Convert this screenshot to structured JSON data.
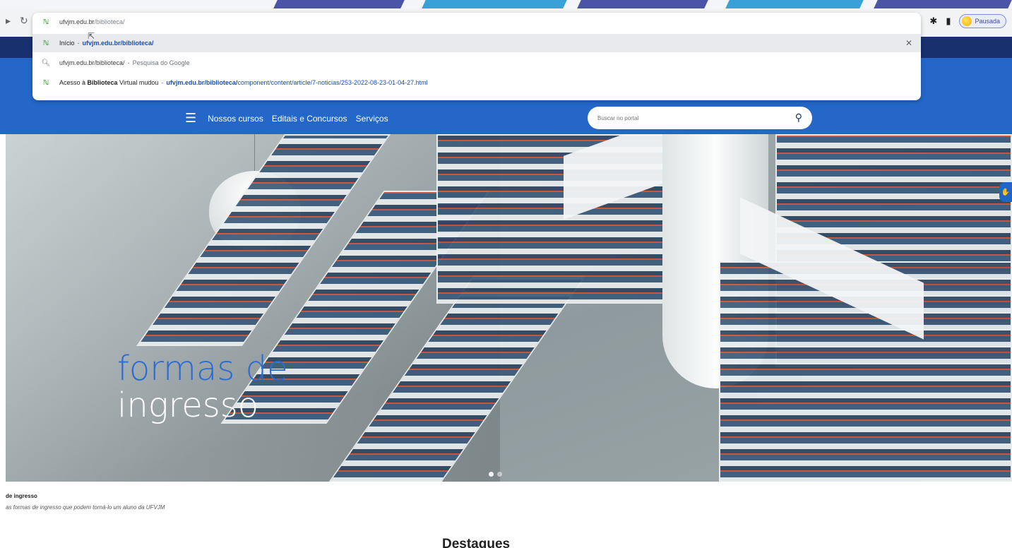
{
  "browser": {
    "address_text": "ufvjm.edu.br/biblioteca/",
    "address_host": "ufvjm.edu.br",
    "address_path": "/biblioteca/",
    "profile_label": "Pausada",
    "suggestions": [
      {
        "icon": "site-favicon",
        "title": "Início",
        "separator": "-",
        "url_bold": "ufvjm.edu.br/biblioteca/",
        "url_rest": ""
      },
      {
        "icon": "search-icon",
        "query": "ufvjm.edu.br/biblioteca/",
        "separator": "-",
        "source": "Pesquisa do Google"
      },
      {
        "icon": "site-favicon",
        "title_pre": "Acesso à ",
        "title_bold": "Biblioteca",
        "title_post": " Virtual mudou",
        "separator": "-",
        "url_bold": "ufvjm.edu.br/biblioteca/",
        "url_rest": "component/content/article/7-noticias/253-2022-08-23-01-04-27.html"
      }
    ]
  },
  "site": {
    "menu": [
      "Nossos cursos",
      "Editais e Concursos",
      "Serviços"
    ],
    "search_placeholder": "Buscar no portal"
  },
  "hero": {
    "title_line1": "formas de",
    "title_line2": "ingresso",
    "slide_count": 2,
    "active_slide": 0
  },
  "caption": {
    "title": "de ingresso",
    "subtitle": "as formas de ingresso que podem torná-lo um aluno da UFVJM"
  },
  "section_heading": "Destaques",
  "colors": {
    "header_blue": "#2467c9",
    "gov_bar": "#18306e",
    "hero_title_blue": "#2c6bd2"
  }
}
